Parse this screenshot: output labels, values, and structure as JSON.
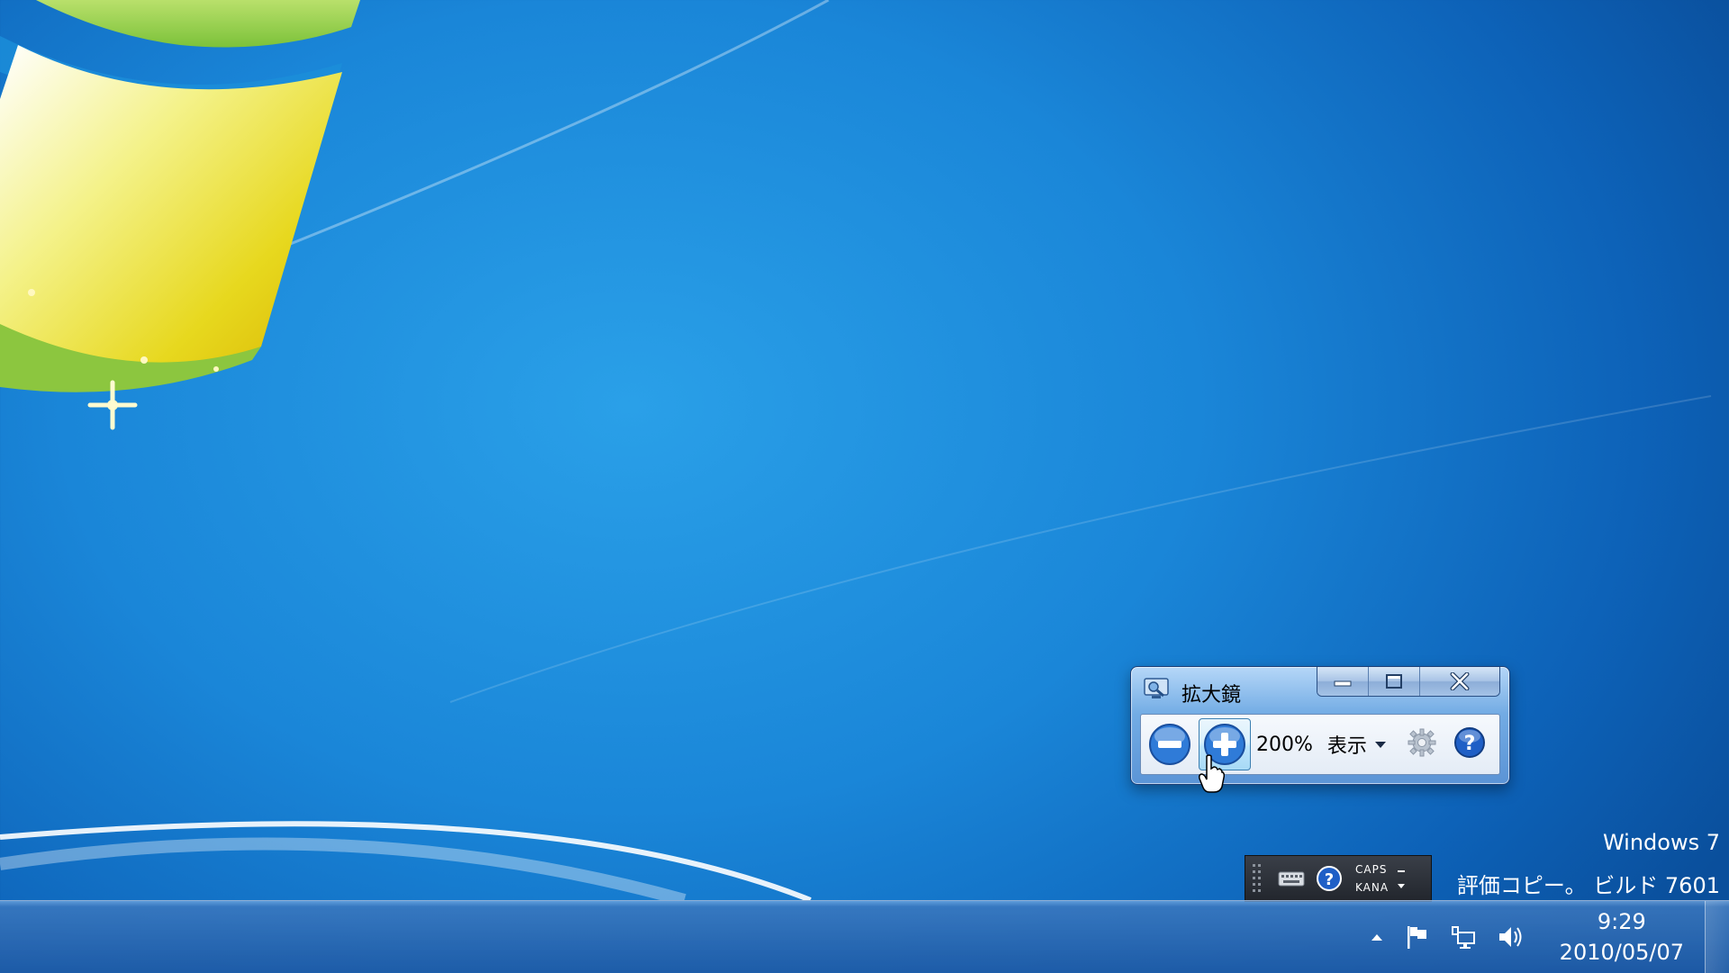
{
  "magnifier": {
    "title": "拡大鏡",
    "zoom_level": "200%",
    "view_menu_label": "表示",
    "icons": {
      "app": "magnifier-app-icon",
      "zoom_out": "minus-icon",
      "zoom_in": "plus-icon",
      "view_dropdown": "chevron-down-icon",
      "options": "gear-icon",
      "help": "help-icon",
      "minimize": "minimize-icon",
      "maximize": "maximize-icon",
      "close": "close-icon"
    }
  },
  "watermark": {
    "line1": "Windows 7",
    "line2": "評価コピー。 ビルド 7601"
  },
  "language_bar": {
    "caps": "CAPS",
    "kana": "KANA"
  },
  "taskbar": {
    "clock_time": "9:29",
    "clock_date": "2010/05/07"
  },
  "colors": {
    "desktop_blue": "#1a86d8",
    "taskbar": "#1e5aa5",
    "help_blue": "#1f5fc6"
  }
}
